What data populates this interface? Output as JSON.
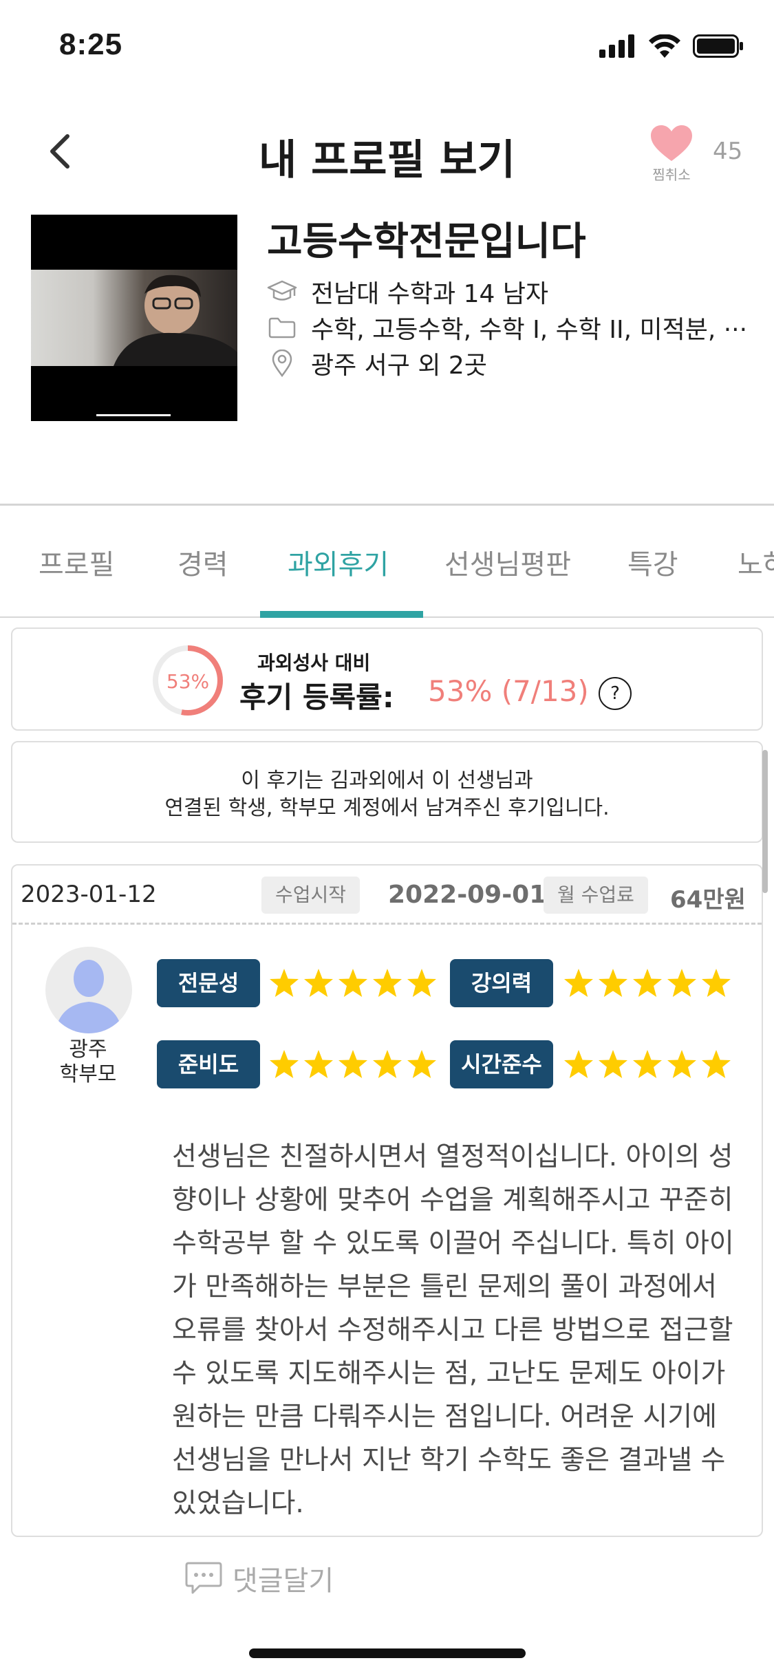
{
  "status": {
    "time": "8:25"
  },
  "header": {
    "title": "내 프로필 보기",
    "fav_label": "찜취소",
    "fav_count": "45"
  },
  "profile": {
    "name": "고등수학전문입니다",
    "education": "전남대 수학과 14 남자",
    "subjects": "수학, 고등수학, 수학 I, 수학 II, 미적분, ···",
    "location": "광주 서구 외 2곳"
  },
  "tabs": [
    "프로필",
    "경력",
    "과외후기",
    "선생님평판",
    "특강",
    "노하"
  ],
  "active_tab": "과외후기",
  "review_rate": {
    "percent_label": "53%",
    "percent": 53,
    "caption": "과외성사 대비",
    "label": "후기 등록률:",
    "value": "53% (7/13)",
    "help": "?"
  },
  "notice": {
    "line1": "이 후기는 김과외에서 이 선생님과",
    "line2": "연결된 학생, 학부모 계정에서 남겨주신 후기입니다."
  },
  "review": {
    "date": "2023-01-12",
    "start_label": "수업시작",
    "start_date": "2022-09-01",
    "fee_label": "월 수업료",
    "fee": "64만원",
    "author_line1": "광주",
    "author_line2": "학부모",
    "scores": [
      {
        "label": "전문성",
        "stars": 5
      },
      {
        "label": "강의력",
        "stars": 5
      },
      {
        "label": "준비도",
        "stars": 5
      },
      {
        "label": "시간준수",
        "stars": 5
      }
    ],
    "body": "선생님은 친절하시면서 열정적이십니다. 아이의 성향이나 상황에 맞추어 수업을 계획해주시고 꾸준히 수학공부 할 수 있도록 이끌어 주십니다. 특히 아이가 만족해하는 부분은 틀린 문제의 풀이 과정에서 오류를 찾아서 수정해주시고 다른 방법으로 접근할 수 있도록 지도해주시는 점, 고난도 문제도 아이가 원하는 만큼 다뤄주시는 점입니다. 어려운 시기에 선생님을 만나서 지난 학기 수학도 좋은 결과낼 수 있었습니다."
  },
  "comment_label": "댓글달기",
  "colors": {
    "accent": "#2fa3a3",
    "badge": "#1a4b6e",
    "rate": "#f07f7a",
    "star": "#ffcc00",
    "heart": "#f6a5ad"
  },
  "icons": [
    "back-arrow-icon",
    "heart-icon",
    "graduation-cap-icon",
    "folder-icon",
    "location-pin-icon",
    "help-icon",
    "star-icon",
    "comment-icon"
  ]
}
